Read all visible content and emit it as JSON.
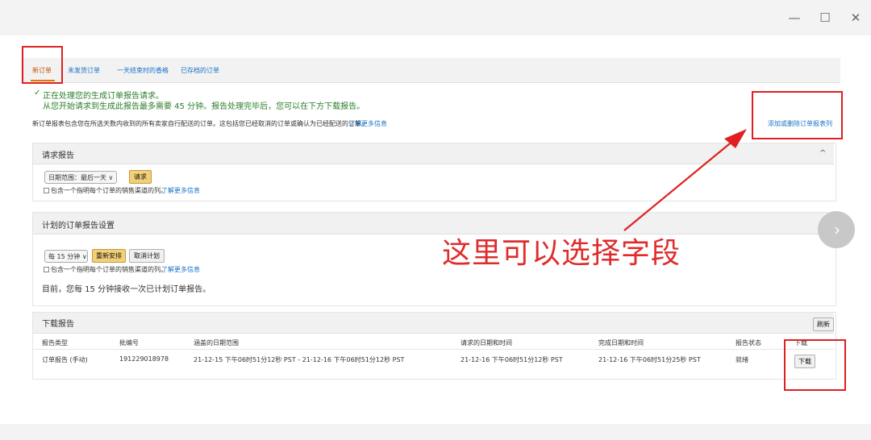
{
  "window": {
    "minimize": "—",
    "maximize": "☐",
    "close": "✕"
  },
  "tabs": [
    {
      "label": "新订单"
    },
    {
      "label": "未发货订单"
    },
    {
      "label": "一天结束时的香格"
    },
    {
      "label": "已存档的订单"
    }
  ],
  "status": {
    "check": "✓",
    "line1": "正在处理您的生成订单报告请求。",
    "line2": "从您开始请求到生成此报告最多需要 45 分钟。报告处理完毕后，您可以在下方下载报告。"
  },
  "info": {
    "text": "新订单报表包含您在所选天数内收到的所有卖家自行配送的订单。这包括您已经取消的订单或确认为已经配送的订单。",
    "learn_more": "了解更多信息",
    "columns_link": "添加或删除订单报表列"
  },
  "request_panel": {
    "title": "请求报告",
    "caret": "^",
    "date_select": "日期范围：最后一天",
    "request_btn": "请求",
    "checkbox_label": "包含一个指明每个订单的销售渠道的列。",
    "learn_more": "了解更多信息"
  },
  "schedule_panel": {
    "title": "计划的订单报告设置",
    "caret": "^",
    "interval_select": "每 15 分钟",
    "reschedule_btn": "重新安排",
    "cancel_btn": "取消计划",
    "checkbox_label": "包含一个指明每个订单的销售渠道的列。",
    "learn_more": "了解更多信息",
    "current": "目前，您每 15 分钟接收一次已计划订单报告。"
  },
  "download_panel": {
    "title": "下载报告",
    "refresh_btn": "刷新",
    "headers": [
      "报告类型",
      "批编号",
      "涵盖的日期范围",
      "请求的日期和时间",
      "完成日期和时间",
      "报告状态",
      "下载"
    ],
    "row": {
      "type": "订单报告 (手动)",
      "batch": "191229018978",
      "range": "21-12-15 下午06时51分12秒 PST - 21-12-16 下午06时51分12秒 PST",
      "requested": "21-12-16 下午06时51分12秒 PST",
      "completed": "21-12-16 下午06时51分25秒 PST",
      "status": "就绪",
      "download_btn": "下载"
    }
  },
  "annotation": {
    "text": "这里可以选择字段",
    "color": "#e02b2b"
  },
  "side_circle_arrow": "›",
  "colors": {
    "accent": "#e77600",
    "link": "#1a73c7",
    "success": "#2a7d2a",
    "annotation_red": "#e02020"
  }
}
